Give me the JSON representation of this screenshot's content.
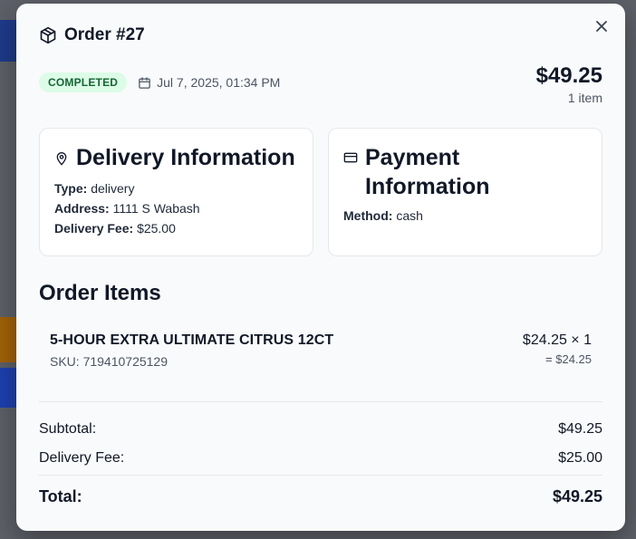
{
  "modal": {
    "title": "Order #27",
    "status": "COMPLETED",
    "date": "Jul 7, 2025, 01:34 PM",
    "total": "$49.25",
    "item_count": "1 item"
  },
  "delivery": {
    "title": "Delivery Information",
    "type_label": "Type:",
    "type_value": "delivery",
    "address_label": "Address:",
    "address_value": "1111 S Wabash",
    "fee_label": "Delivery Fee:",
    "fee_value": "$25.00"
  },
  "payment": {
    "title": "Payment Information",
    "method_label": "Method:",
    "method_value": "cash"
  },
  "items_section": {
    "title": "Order Items",
    "items": [
      {
        "name": "5-HOUR EXTRA ULTIMATE CITRUS 12CT",
        "sku": "SKU: 719410725129",
        "price_qty": "$24.25 × 1",
        "line_total": "= $24.25"
      }
    ]
  },
  "summary": {
    "subtotal_label": "Subtotal:",
    "subtotal_value": "$49.25",
    "fee_label": "Delivery Fee:",
    "fee_value": "$25.00",
    "total_label": "Total:",
    "total_value": "$49.25"
  },
  "colors": {
    "badge_bg": "#dcfce7",
    "badge_text": "#166534",
    "overlay": "#4a4d55"
  },
  "icons": {
    "title": "package-icon",
    "date": "calendar-icon",
    "delivery": "map-pin-icon",
    "payment": "credit-card-icon",
    "close": "close-icon"
  }
}
